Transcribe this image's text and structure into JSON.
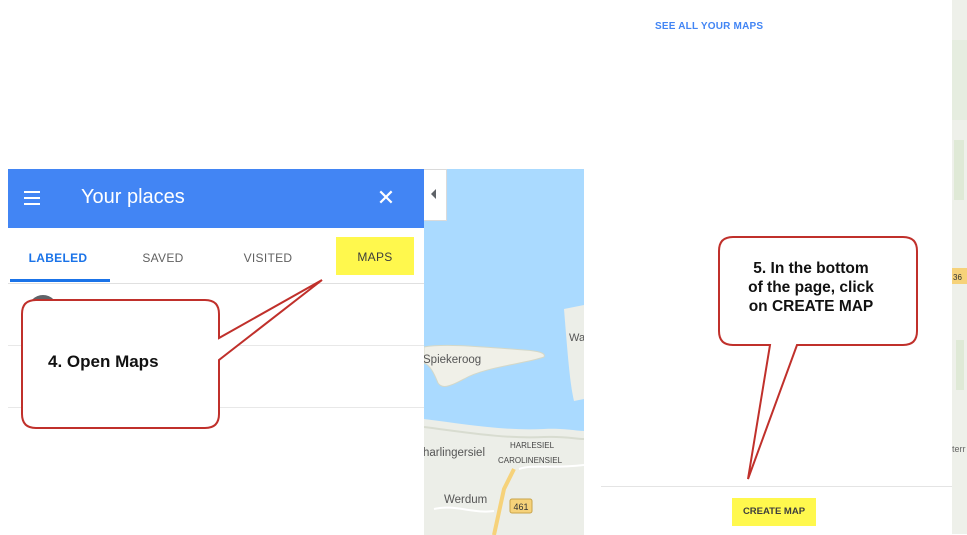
{
  "left_panel": {
    "title": "Your places",
    "tabs": [
      {
        "label": "LABELED",
        "active": true
      },
      {
        "label": "SAVED",
        "active": false
      },
      {
        "label": "VISITED",
        "active": false
      },
      {
        "label": "MAPS",
        "active": false,
        "highlighted": true
      }
    ]
  },
  "map_left": {
    "labels": [
      "Spiekeroog",
      "Wa",
      "harlingersiel",
      "HARLESIEL",
      "CAROLINENSIEL",
      "Werdum"
    ],
    "road_badge": "461"
  },
  "right_panel": {
    "see_all_link": "SEE ALL YOUR MAPS",
    "create_map_button": "CREATE MAP",
    "map_strip_labels": [
      "36",
      "terr"
    ]
  },
  "callouts": [
    {
      "text": "4. Open Maps"
    },
    {
      "lines": [
        "5. In the bottom",
        "of the page, click",
        "on CREATE MAP"
      ]
    }
  ],
  "colors": {
    "header_blue": "#4285f4",
    "active_tab_blue": "#1a73e8",
    "highlight_yellow": "#fff84d",
    "callout_border": "#c0302b",
    "water": "#aadaff"
  }
}
